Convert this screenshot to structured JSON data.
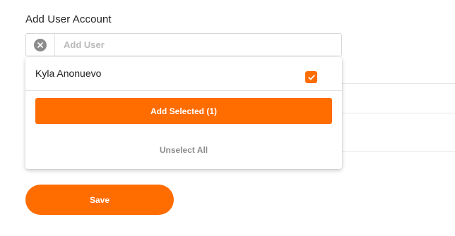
{
  "form": {
    "field_label": "Add User Account",
    "search_placeholder": "Add User",
    "search_value": ""
  },
  "dropdown": {
    "options": [
      {
        "label": "Kyla Anonuevo",
        "checked": true
      }
    ],
    "add_selected_label": "Add Selected (1)",
    "unselect_all_label": "Unselect All"
  },
  "actions": {
    "save_label": "Save"
  },
  "icons": {
    "clear": "close-circle-icon",
    "check": "checkmark-icon"
  },
  "colors": {
    "accent": "#ff6c00",
    "clear_icon_bg": "#8c8c8c",
    "muted_text": "#8d8d8d",
    "placeholder": "#b9b9b9"
  }
}
